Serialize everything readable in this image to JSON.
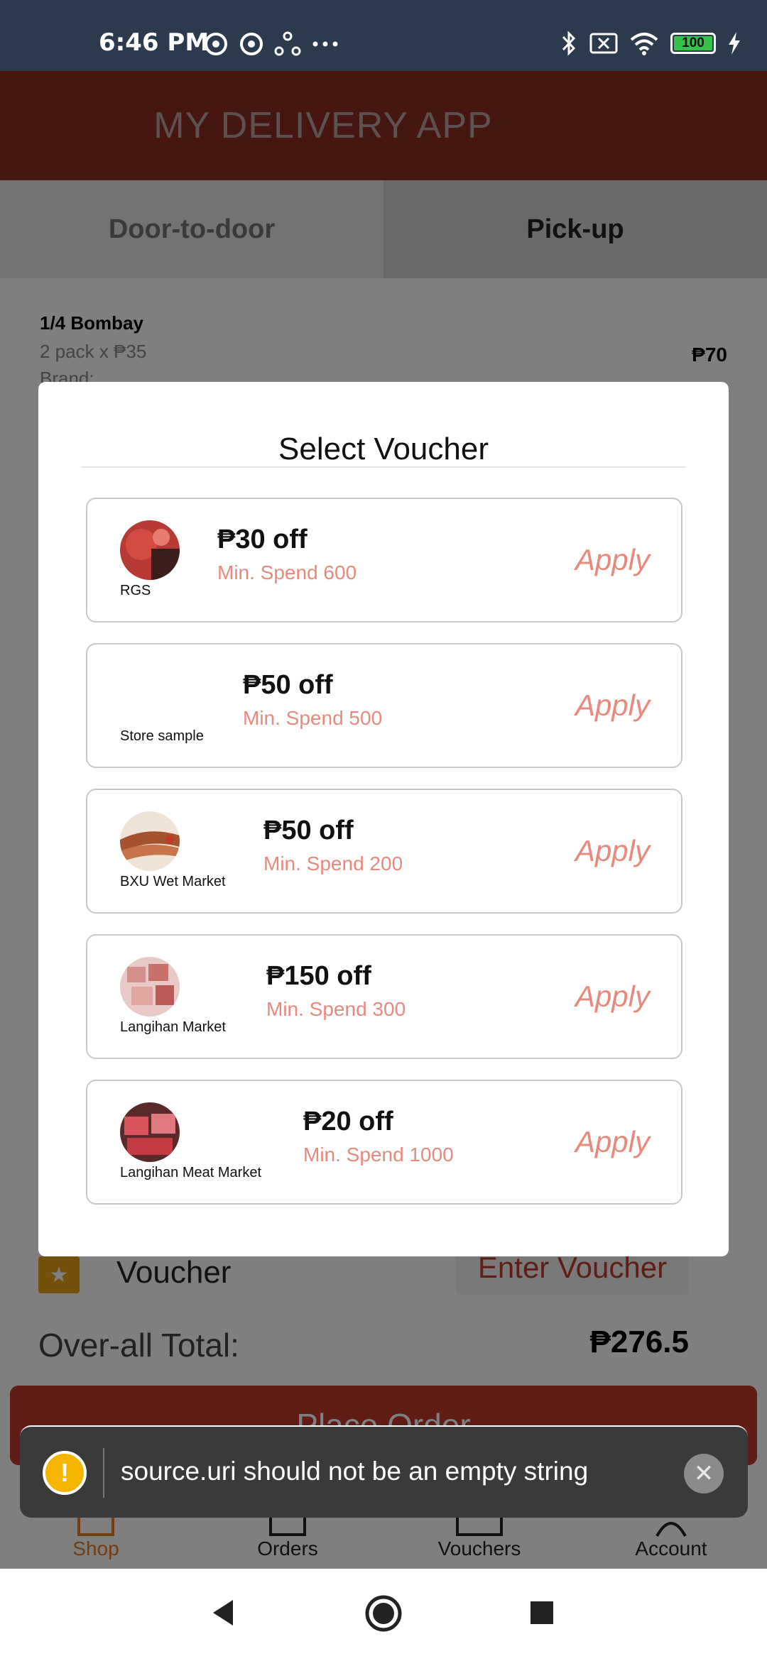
{
  "status_bar": {
    "time": "6:46 PM",
    "battery": "100"
  },
  "app": {
    "title": "MY DELIVERY APP"
  },
  "tabs": [
    {
      "label": "Door-to-door"
    },
    {
      "label": "Pick-up"
    }
  ],
  "cart_item": {
    "name": "1/4 Bombay",
    "qty": "2 pack x ₱35",
    "brand": "Brand:",
    "price": "₱70"
  },
  "voucher_row": {
    "label": "Voucher",
    "button": "Enter Voucher"
  },
  "total": {
    "label": "Over-all Total:",
    "value": "₱276.5"
  },
  "place_order": "Place Order",
  "bottom_nav": [
    {
      "label": "Shop"
    },
    {
      "label": "Orders"
    },
    {
      "label": "Vouchers"
    },
    {
      "label": "Account"
    }
  ],
  "modal": {
    "title": "Select Voucher",
    "vouchers": [
      {
        "store": "RGS",
        "off": "₱30 off",
        "min": "Min. Spend 600",
        "apply": "Apply"
      },
      {
        "store": "Store sample",
        "off": "₱50 off",
        "min": "Min. Spend 500",
        "apply": "Apply"
      },
      {
        "store": "BXU Wet Market",
        "off": "₱50 off",
        "min": "Min. Spend 200",
        "apply": "Apply"
      },
      {
        "store": "Langihan Market",
        "off": "₱150 off",
        "min": "Min. Spend 300",
        "apply": "Apply"
      },
      {
        "store": "Langihan Meat Market",
        "off": "₱20 off",
        "min": "Min. Spend 1000",
        "apply": "Apply"
      }
    ]
  },
  "toast": {
    "message": "source.uri should not be an empty string"
  },
  "colors": {
    "header": "#8c2d22",
    "accent": "#c0392b",
    "apply": "#e8897e",
    "toast": "#3a3a3a"
  }
}
